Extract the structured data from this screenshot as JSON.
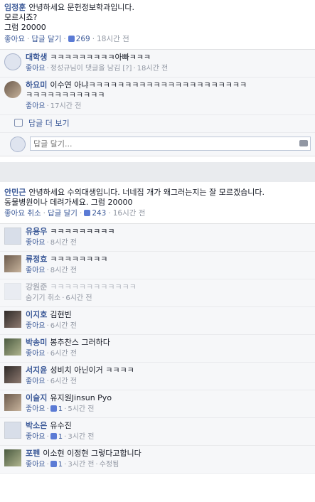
{
  "post1": {
    "author": "임정훈",
    "lines": [
      "안녕하세요 문헌정보학과입니다.",
      "모르시죠?",
      "그럼 20000"
    ],
    "actions": {
      "like": "좋아요",
      "reply": "답글 달기",
      "like_count": "269",
      "time": "18시간 전"
    },
    "comments": [
      {
        "name": "대학생",
        "text": "ㅋㅋㅋㅋㅋㅋㅋㅋㅋ아빠ㅋㅋㅋ",
        "like": "좋아요",
        "extra": "정성규님이 댓글을 남김",
        "extra2": "[?]",
        "time": "18시간 전"
      },
      {
        "name": "하요미",
        "text": "이수연 아냐ㅋㅋㅋㅋㅋㅋㅋㅋㅋㅋㅋㅋㅋㅋㅋㅋㅋㅋㅋㅋㅋㅋ",
        "text2": "ㅋㅋㅋㅋㅋㅋㅋㅋㅋㅋㅋ",
        "like": "좋아요",
        "time": "17시간 전"
      }
    ],
    "more_replies": "답글 더 보기",
    "reply_placeholder": "답글 달기..."
  },
  "post2": {
    "author": "안민근",
    "lines": [
      "안녕하세요 수의대생입니다. 너네집 개가 왜그러는지는 잘 모르겠습니다.",
      "동물병원이나 데려가세요. 그럼 20000"
    ],
    "actions": {
      "like": "좋아요 취소",
      "reply": "답글 달기",
      "like_count": "243",
      "time": "16시간 전"
    },
    "comments": [
      {
        "name": "유용우",
        "text": "ㅋㅋㅋㅋㅋㅋㅋㅋㅋ",
        "like": "좋아요",
        "time": "8시간 전"
      },
      {
        "name": "류정효",
        "text": "ㅋㅋㅋㅋㅋㅋㅋㅋ",
        "like": "좋아요",
        "time": "8시간 전"
      },
      {
        "name": "강원준",
        "text": "ㅋㅋㅋㅋㅋㅋㅋㅋㅋㅋㅋㅋ",
        "like": "숨기기 취소",
        "time": "6시간 전"
      },
      {
        "name": "이지호",
        "text": "김현빈",
        "like": "좋아요",
        "time": "6시간 전"
      },
      {
        "name": "박송미",
        "text": "봉추찬스 그러하다",
        "like": "좋아요",
        "time": "6시간 전"
      },
      {
        "name": "서지윤",
        "text": "성비치 아닌이거 ㅋㅋㅋㅋ",
        "like": "좋아요",
        "time": "6시간 전"
      },
      {
        "name": "이슬지",
        "text": "유지원Jinsun Pyo",
        "like": "좋아요",
        "like_count": "1",
        "time": "5시간 전"
      },
      {
        "name": "박소은",
        "text": "유수진",
        "like": "좋아요",
        "like_count": "1",
        "time": "3시간 전"
      },
      {
        "name": "포펜",
        "text": "이소현 이정현 그렇다고합니다",
        "like": "좋아요",
        "like_count": "1",
        "time": "3시간 전",
        "edited": "수정됨"
      }
    ]
  }
}
